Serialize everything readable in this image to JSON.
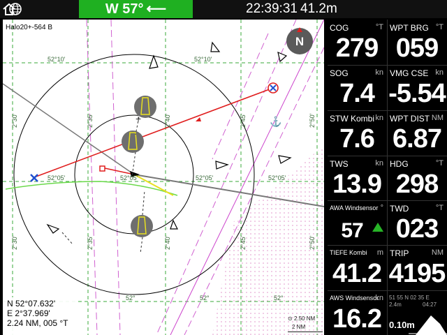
{
  "topbar": {
    "wind_display": "W 57°",
    "time": "22:39:31",
    "depth": "41.2m",
    "icons": [
      "home-icon",
      "globe-icon",
      "wind-arrow-icon"
    ],
    "accent": "#1fb021"
  },
  "chart": {
    "vessel_name": "Halo20+-564 B",
    "north_label": "N",
    "lat_labels": [
      "52°10'",
      "52°10'",
      "52°05'",
      "52°05'",
      "52°05'",
      "52°",
      "52°",
      "52°"
    ],
    "lon_labels": [
      "2°30'",
      "2°35'",
      "2°40'",
      "2°45'",
      "2°50'"
    ],
    "position": {
      "lat": "N  52°07.632'",
      "lon": "E   2°37.969'",
      "bearing": "2.24 NM, 005 °T"
    },
    "scale": {
      "range": "2.50 NM",
      "bar": "2 NM"
    }
  },
  "panel": {
    "cells": [
      {
        "label": "COG",
        "unit": "°T",
        "value": "279"
      },
      {
        "label": "WPT BRG",
        "unit": "°T",
        "value": "059"
      },
      {
        "label": "SOG",
        "unit": "kn",
        "value": "7.4"
      },
      {
        "label": "VMG CSE",
        "unit": "kn",
        "value": "-5.54"
      },
      {
        "label": "STW Kombi",
        "unit": "kn",
        "value": "7.6"
      },
      {
        "label": "WPT DIST",
        "unit": "NM",
        "value": "6.87"
      },
      {
        "label": "TWS",
        "unit": "kn",
        "value": "13.9"
      },
      {
        "label": "HDG",
        "unit": "°T",
        "value": "298"
      },
      {
        "label": "AWA Windsensor",
        "unit": "°",
        "value": "57"
      },
      {
        "label": "TWD",
        "unit": "°T",
        "value": "023"
      },
      {
        "label": "TIEFE Kombi",
        "unit": "m",
        "value": "41.2"
      },
      {
        "label": "TRIP",
        "unit": "NM",
        "value": "4195"
      },
      {
        "label": "AWS Windsensor",
        "unit": "kn",
        "value": "16.2"
      }
    ],
    "mini": {
      "coords": "51 55 N 02 35 E",
      "depth_left": "2.4m",
      "clock": "04:27",
      "depth_value": "0.10m"
    }
  }
}
